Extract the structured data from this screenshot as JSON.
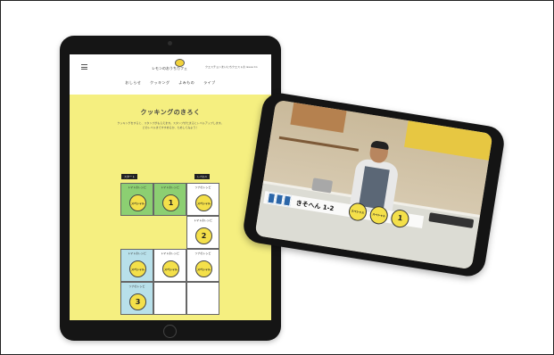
{
  "site": {
    "menu_icon": "hamburger-menu-icon",
    "logo_text": "レモンのおうちカフェ",
    "header_right": "クエスチョンまいにちクエストの issue Co",
    "nav": [
      "おしらせ",
      "クッキング",
      "よみもの",
      "ライブ"
    ]
  },
  "page": {
    "title": "クッキングのきろく",
    "intro_line1": "クッキングをすると、スタンプがもらえます。スタンプがたまるとレベルアップします。",
    "intro_line2": "どのレベルまですすめるか、ためしてみよう！"
  },
  "board": {
    "tag_start": "スタート",
    "tag_level_a": "レベル1",
    "tag_level_b": "レベル2",
    "cells": [
      {
        "label": "トマトのレシピ",
        "style": "green",
        "lemon": "スペシャル"
      },
      {
        "label": "トマトのレシピ",
        "style": "green",
        "lemon": "1"
      },
      {
        "label": "ツナのレシピ",
        "style": "white",
        "lemon": "スペシャル"
      },
      {
        "label": "",
        "style": "white",
        "lemon": ""
      },
      {
        "label": "",
        "style": "white",
        "lemon": ""
      },
      {
        "label": "トマトのレシピ",
        "style": "white",
        "lemon": "2"
      },
      {
        "label": "トマトのレシピ",
        "style": "blue",
        "lemon": "スペシャル"
      },
      {
        "label": "トマトのレシピ",
        "style": "white",
        "lemon": "スペシャル"
      },
      {
        "label": "ツナのレシピ",
        "style": "white",
        "lemon": "スペシャル"
      },
      {
        "label": "ツナのレシピ",
        "style": "blue",
        "lemon": "3"
      },
      {
        "label": "",
        "style": "white",
        "lemon": ""
      },
      {
        "label": "",
        "style": "white",
        "lemon": ""
      }
    ]
  },
  "phone": {
    "overlay_title": "きそへん 1-2",
    "overlay_boxes": [
      "さ",
      "ほ",
      "る"
    ],
    "lemons": [
      "スペシャル",
      "スペシャル",
      "1"
    ]
  },
  "colors": {
    "page_bg": "#f5ef80",
    "green": "#8ccf72",
    "blue": "#b8e0ea",
    "lemon": "#f4e04a"
  }
}
